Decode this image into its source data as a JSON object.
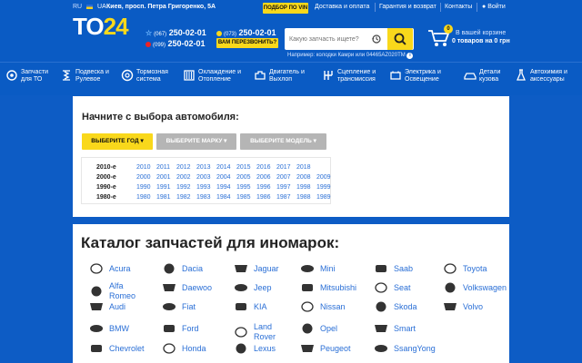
{
  "header": {
    "languages": {
      "ru": "RU",
      "ua": "UA"
    },
    "address": "Киев, просп. Петра Григоренко, 5А",
    "vin_button": "ПОДБОР ПО VIN",
    "links": [
      "Доставка и оплата",
      "Гарантия и возврат",
      "Контакты"
    ],
    "login": "Войти",
    "logo_main": "TO",
    "logo_accent": "24",
    "phones": [
      {
        "code": "(067)",
        "number": "250-02-01"
      },
      {
        "code": "(073)",
        "number": "250-02-01"
      },
      {
        "code": "(099)",
        "number": "250-02-01"
      }
    ],
    "callback_button": "ВАМ ПЕРЕЗВОНИТЬ?",
    "search_placeholder": "Какую запчасть ищете?",
    "search_example": "Например: колодки Камри или 04465AZ020TM",
    "cart": {
      "count": "0",
      "line1": "В вашей корзине",
      "line2": "0 товаров на 0 грн"
    }
  },
  "nav": [
    {
      "label": "Запчасти\nдля ТО",
      "icon": "service-parts-icon"
    },
    {
      "label": "Подвеска и\nРулевое",
      "icon": "suspension-icon"
    },
    {
      "label": "Тормозная\nсистема",
      "icon": "brake-disc-icon"
    },
    {
      "label": "Охлаждение и\nОтопление",
      "icon": "cooling-icon"
    },
    {
      "label": "Двигатель и\nВыхлоп",
      "icon": "engine-icon"
    },
    {
      "label": "Сцепление и\nтрансмиссия",
      "icon": "transmission-icon"
    },
    {
      "label": "Электрика и\nОсвещение",
      "icon": "electrics-icon"
    },
    {
      "label": "Детали\nкузова",
      "icon": "body-parts-icon"
    },
    {
      "label": "Автохимия и\nаксессуары",
      "icon": "chemistry-icon"
    }
  ],
  "selector": {
    "title": "Начните с выбора автомобиля:",
    "buttons": [
      "ВЫБЕРИТЕ ГОД ▾",
      "ВЫБЕРИТЕ МАРКУ ▾",
      "ВЫБЕРИТЕ МОДЕЛЬ ▾"
    ],
    "decades": [
      {
        "label": "2010-е",
        "years": [
          "2010",
          "2011",
          "2012",
          "2013",
          "2014",
          "2015",
          "2016",
          "2017",
          "2018"
        ]
      },
      {
        "label": "2000-е",
        "years": [
          "2000",
          "2001",
          "2002",
          "2003",
          "2004",
          "2005",
          "2006",
          "2007",
          "2008",
          "2009"
        ]
      },
      {
        "label": "1990-е",
        "years": [
          "1990",
          "1991",
          "1992",
          "1993",
          "1994",
          "1995",
          "1996",
          "1997",
          "1998",
          "1999"
        ]
      },
      {
        "label": "1980-е",
        "years": [
          "1980",
          "1981",
          "1982",
          "1983",
          "1984",
          "1985",
          "1986",
          "1987",
          "1988",
          "1989"
        ]
      }
    ]
  },
  "catalog": {
    "title": "Каталог запчастей для иномарок:",
    "columns": [
      [
        {
          "name": "Acura"
        },
        {
          "name": "Alfa\nRomeo"
        },
        {
          "name": "Audi"
        },
        {
          "name": "BMW"
        },
        {
          "name": "Chevrolet"
        }
      ],
      [
        {
          "name": "Dacia"
        },
        {
          "name": "Daewoo"
        },
        {
          "name": "Fiat"
        },
        {
          "name": "Ford"
        },
        {
          "name": "Honda"
        }
      ],
      [
        {
          "name": "Jaguar"
        },
        {
          "name": "Jeep"
        },
        {
          "name": "KIA"
        },
        {
          "name": "Land\nRover"
        },
        {
          "name": "Lexus"
        }
      ],
      [
        {
          "name": "Mini"
        },
        {
          "name": "Mitsubishi"
        },
        {
          "name": "Nissan"
        },
        {
          "name": "Opel"
        },
        {
          "name": "Peugeot"
        }
      ],
      [
        {
          "name": "Saab"
        },
        {
          "name": "Seat"
        },
        {
          "name": "Skoda"
        },
        {
          "name": "Smart"
        },
        {
          "name": "SsangYong"
        }
      ],
      [
        {
          "name": "Toyota"
        },
        {
          "name": "Volkswagen"
        },
        {
          "name": "Volvo"
        }
      ]
    ]
  },
  "colors": {
    "brand_blue": "#0a5bc4",
    "accent_yellow": "#f9d81b",
    "link_blue": "#2a6fd6"
  }
}
